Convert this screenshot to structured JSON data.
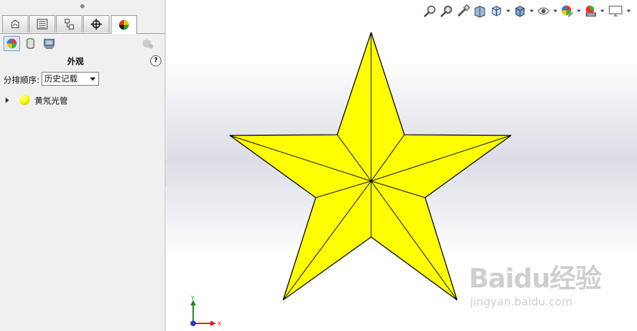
{
  "panel": {
    "title": "外观",
    "help": "?",
    "sort_label": "分排顺序:",
    "sort_value": "历史记载",
    "tree_item_label": "黄氖光管"
  },
  "panel_tabs": [
    {
      "name": "tab-featuremanager",
      "icon": "feature-tree-icon"
    },
    {
      "name": "tab-propertymanager",
      "icon": "property-list-icon"
    },
    {
      "name": "tab-configurationmanager",
      "icon": "configuration-icon"
    },
    {
      "name": "tab-dimxpert",
      "icon": "crosshair-icon"
    },
    {
      "name": "tab-display-manager",
      "icon": "appearance-ball-icon",
      "active": true
    }
  ],
  "view_toolbar": [
    "zoom-to-fit-icon",
    "zoom-to-area-icon",
    "previous-view-icon",
    "section-view-icon",
    "view-orientation-icon",
    "display-style-icon",
    "hide-show-items-icon",
    "edit-appearance-icon",
    "apply-scene-icon",
    "view-settings-icon"
  ],
  "triad": {
    "y_label": "Y",
    "x_label": "X"
  },
  "watermark": {
    "main": "Baidu经验",
    "sub": "jingyan.baidu.com"
  },
  "colors": {
    "star_fill": "#ffff00",
    "star_stroke": "#000000",
    "accent": "#316ac5"
  }
}
